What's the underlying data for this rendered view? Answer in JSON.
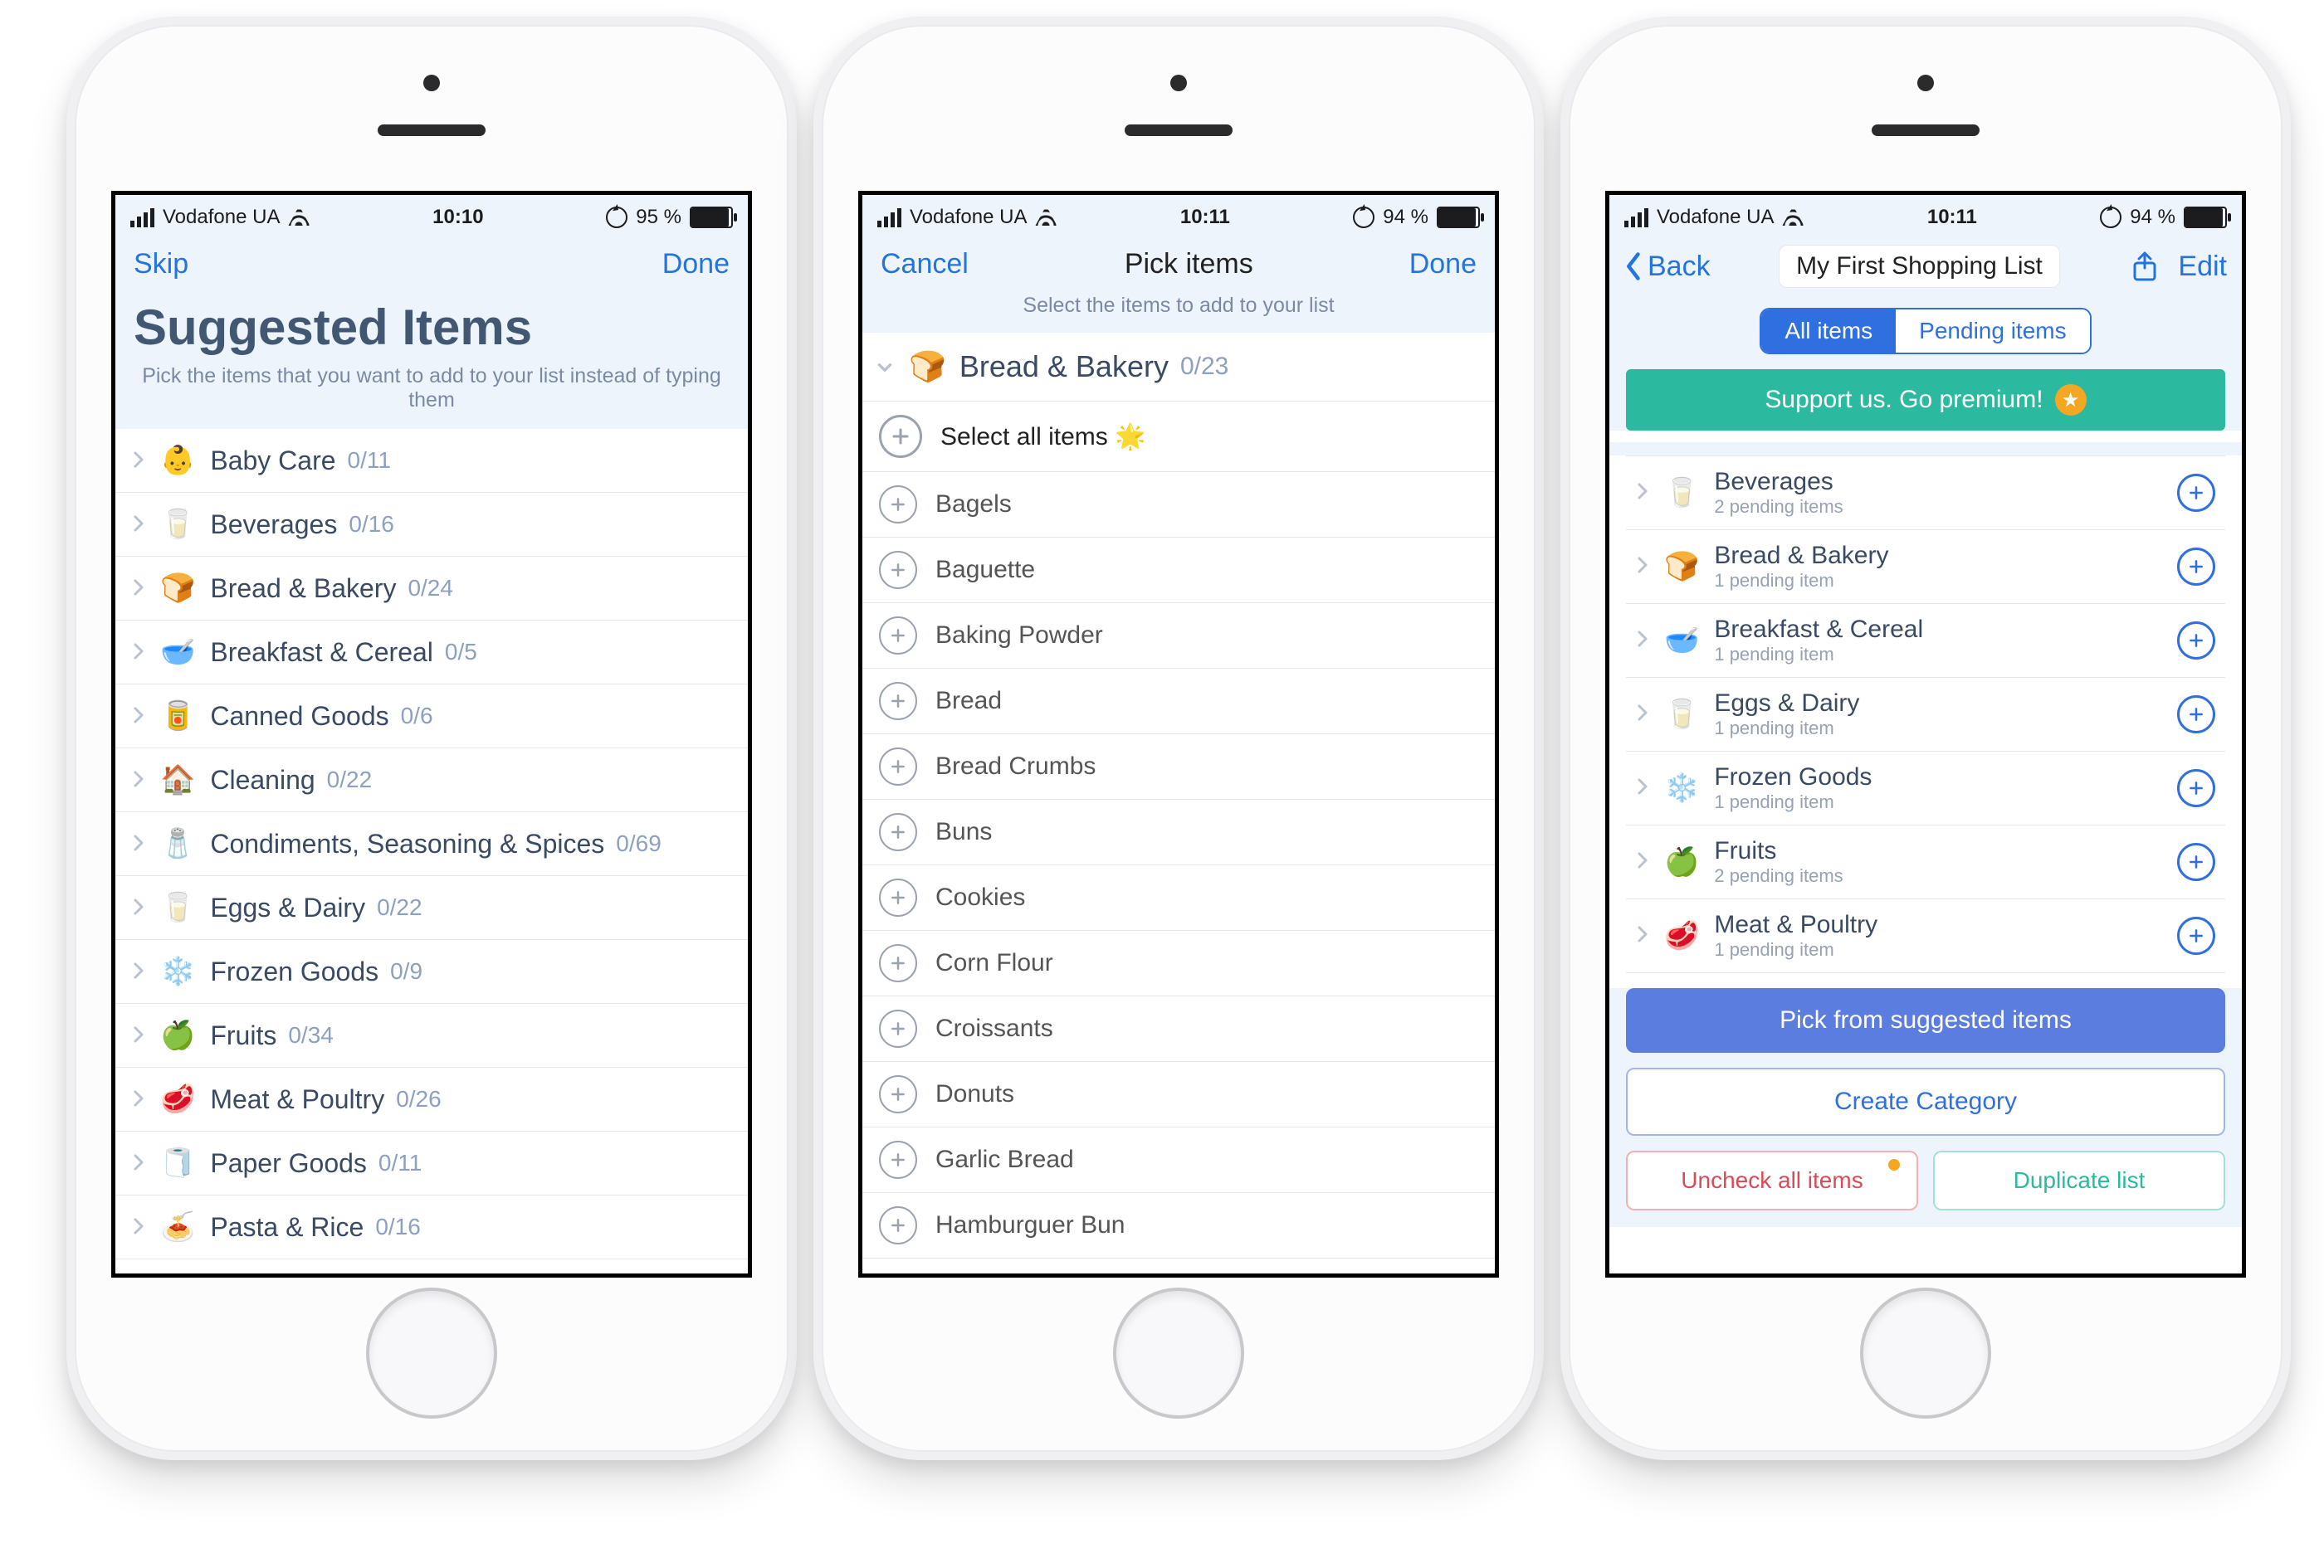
{
  "status": {
    "carrier": "Vodafone UA",
    "time1": "10:10",
    "time2": "10:11",
    "batt1": "95 %",
    "batt2": "94 %"
  },
  "screen1": {
    "nav_left": "Skip",
    "nav_right": "Done",
    "title": "Suggested Items",
    "subtitle": "Pick the items that you want to add to your list instead of typing them",
    "categories": [
      {
        "emoji": "👶",
        "name": "Baby Care",
        "count": "0/11"
      },
      {
        "emoji": "🥛",
        "name": "Beverages",
        "count": "0/16"
      },
      {
        "emoji": "🍞",
        "name": "Bread & Bakery",
        "count": "0/24"
      },
      {
        "emoji": "🥣",
        "name": "Breakfast & Cereal",
        "count": "0/5"
      },
      {
        "emoji": "🥫",
        "name": "Canned Goods",
        "count": "0/6"
      },
      {
        "emoji": "🏠",
        "name": "Cleaning",
        "count": "0/22"
      },
      {
        "emoji": "🧂",
        "name": "Condiments, Seasoning & Spices",
        "count": "0/69"
      },
      {
        "emoji": "🥛",
        "name": "Eggs & Dairy",
        "count": "0/22"
      },
      {
        "emoji": "❄️",
        "name": "Frozen Goods",
        "count": "0/9"
      },
      {
        "emoji": "🍏",
        "name": "Fruits",
        "count": "0/34"
      },
      {
        "emoji": "🥩",
        "name": "Meat & Poultry",
        "count": "0/26"
      },
      {
        "emoji": "🧻",
        "name": "Paper Goods",
        "count": "0/11"
      },
      {
        "emoji": "🍝",
        "name": "Pasta & Rice",
        "count": "0/16"
      }
    ]
  },
  "screen2": {
    "nav_left": "Cancel",
    "nav_center": "Pick items",
    "nav_right": "Done",
    "instruction": "Select the items to add to your list",
    "expanded": {
      "emoji": "🍞",
      "name": "Bread & Bakery",
      "count": "0/23"
    },
    "select_all": "Select all items 🌟",
    "items": [
      "Bagels",
      "Baguette",
      "Baking Powder",
      "Bread",
      "Bread Crumbs",
      "Buns",
      "Cookies",
      "Corn Flour",
      "Croissants",
      "Donuts",
      "Garlic Bread",
      "Hamburguer Bun"
    ]
  },
  "screen3": {
    "back": "Back",
    "title": "My First Shopping List",
    "edit": "Edit",
    "tabs": {
      "all": "All items",
      "pending": "Pending items"
    },
    "banner": "Support us. Go premium!",
    "categories": [
      {
        "emoji": "🥛",
        "name": "Beverages",
        "pending": "2 pending items"
      },
      {
        "emoji": "🍞",
        "name": "Bread & Bakery",
        "pending": "1 pending item"
      },
      {
        "emoji": "🥣",
        "name": "Breakfast & Cereal",
        "pending": "1 pending item"
      },
      {
        "emoji": "🥛",
        "name": "Eggs & Dairy",
        "pending": "1 pending item"
      },
      {
        "emoji": "❄️",
        "name": "Frozen Goods",
        "pending": "1 pending item"
      },
      {
        "emoji": "🍏",
        "name": "Fruits",
        "pending": "2 pending items"
      },
      {
        "emoji": "🥩",
        "name": "Meat & Poultry",
        "pending": "1 pending item"
      }
    ],
    "pick_btn": "Pick from suggested items",
    "create_btn": "Create Category",
    "uncheck_btn": "Uncheck all items",
    "duplicate_btn": "Duplicate list"
  }
}
